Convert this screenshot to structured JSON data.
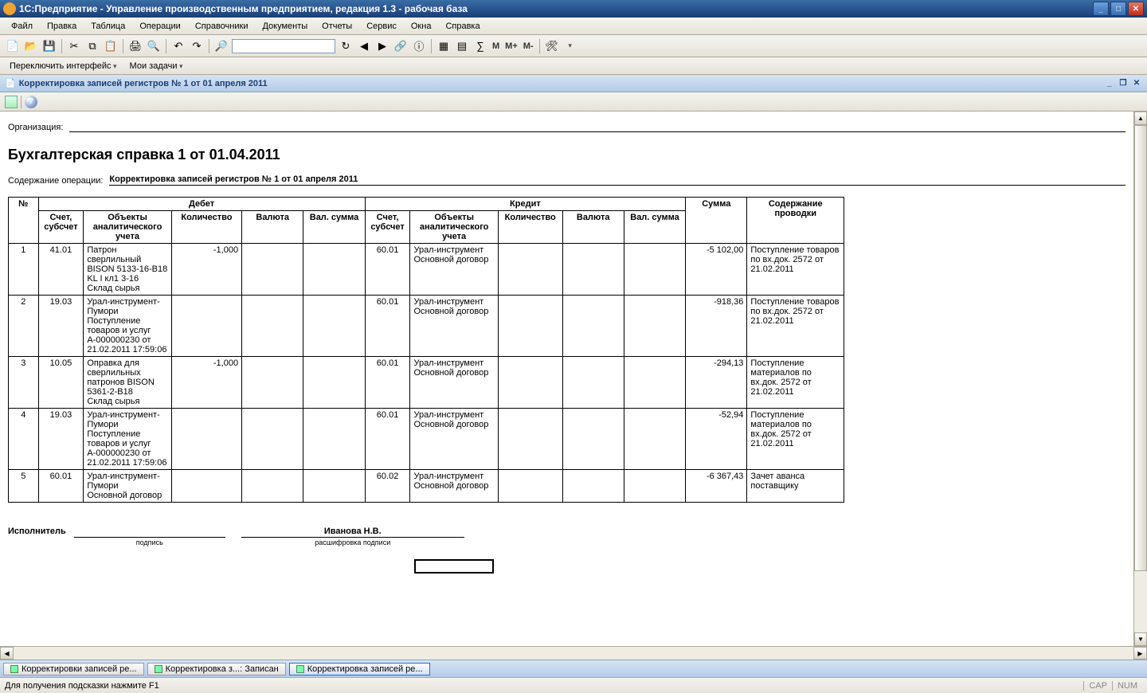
{
  "window": {
    "title": "1С:Предприятие - Управление производственным предприятием, редакция 1.3 - рабочая база"
  },
  "menu": [
    "Файл",
    "Правка",
    "Таблица",
    "Операции",
    "Справочники",
    "Документы",
    "Отчеты",
    "Сервис",
    "Окна",
    "Справка"
  ],
  "subbar": {
    "switch": "Переключить интерфейс",
    "tasks": "Мои задачи"
  },
  "doc_header": "Корректировка записей регистров № 1 от 01 апреля 2011",
  "tb_letters": {
    "m": "M",
    "mp": "M+",
    "mm": "M-"
  },
  "report": {
    "org_label": "Организация:",
    "title": "Бухгалтерская справка 1 от 01.04.2011",
    "op_label": "Содержание операции:",
    "op_value": "Корректировка записей регистров № 1 от 01 апреля 2011",
    "headers": {
      "no": "№",
      "debit": "Дебет",
      "credit": "Кредит",
      "sum": "Сумма",
      "content": "Содержание проводки",
      "acct": "Счет, субсчет",
      "obj": "Объекты аналитического учета",
      "qty": "Количество",
      "cur": "Валюта",
      "csum": "Вал. сумма"
    },
    "rows": [
      {
        "n": "1",
        "d_acct": "41.01",
        "d_obj": "Патрон сверлильный BISON 5133-16-B18 KL I кл1 3-16\nСклад сырья",
        "d_qty": "-1,000",
        "c_acct": "60.01",
        "c_obj": "Урал-инструмент\nОсновной договор",
        "sum": "-5 102,00",
        "content": "Поступление товаров по вх.док. 2572 от 21.02.2011"
      },
      {
        "n": "2",
        "d_acct": "19.03",
        "d_obj": "Урал-инструмент-Пумори\nПоступление товаров и услуг А-000000230 от 21.02.2011 17:59:06",
        "d_qty": "",
        "c_acct": "60.01",
        "c_obj": "Урал-инструмент\nОсновной договор",
        "sum": "-918,36",
        "content": "Поступление товаров по вх.док. 2572 от 21.02.2011"
      },
      {
        "n": "3",
        "d_acct": "10.05",
        "d_obj": "Оправка для сверлильных патронов BISON 5361-2-B18\nСклад сырья",
        "d_qty": "-1,000",
        "c_acct": "60.01",
        "c_obj": "Урал-инструмент\nОсновной договор",
        "sum": "-294,13",
        "content": "Поступление материалов по вх.док. 2572 от 21.02.2011"
      },
      {
        "n": "4",
        "d_acct": "19.03",
        "d_obj": "Урал-инструмент-Пумори\nПоступление товаров и услуг А-000000230 от 21.02.2011 17:59:06",
        "d_qty": "",
        "c_acct": "60.01",
        "c_obj": "Урал-инструмент\nОсновной договор",
        "sum": "-52,94",
        "content": "Поступление материалов по вх.док. 2572 от 21.02.2011"
      },
      {
        "n": "5",
        "d_acct": "60.01",
        "d_obj": "Урал-инструмент-Пумори\nОсновной договор",
        "d_qty": "",
        "c_acct": "60.02",
        "c_obj": "Урал-инструмент\nОсновной договор",
        "sum": "-6 367,43",
        "content": "Зачет аванса поставщику"
      }
    ],
    "signer": {
      "label": "Исполнитель",
      "sig_caption": "подпись",
      "name": "Иванова Н.В.",
      "name_caption": "расшифровка подписи"
    }
  },
  "tabs": [
    {
      "label": "Корректировки записей ре...",
      "active": false
    },
    {
      "label": "Корректировка з...: Записан",
      "active": false
    },
    {
      "label": "Корректировка записей ре...",
      "active": true
    }
  ],
  "status": {
    "hint": "Для получения подсказки нажмите F1",
    "cap": "CAP",
    "num": "NUM"
  }
}
